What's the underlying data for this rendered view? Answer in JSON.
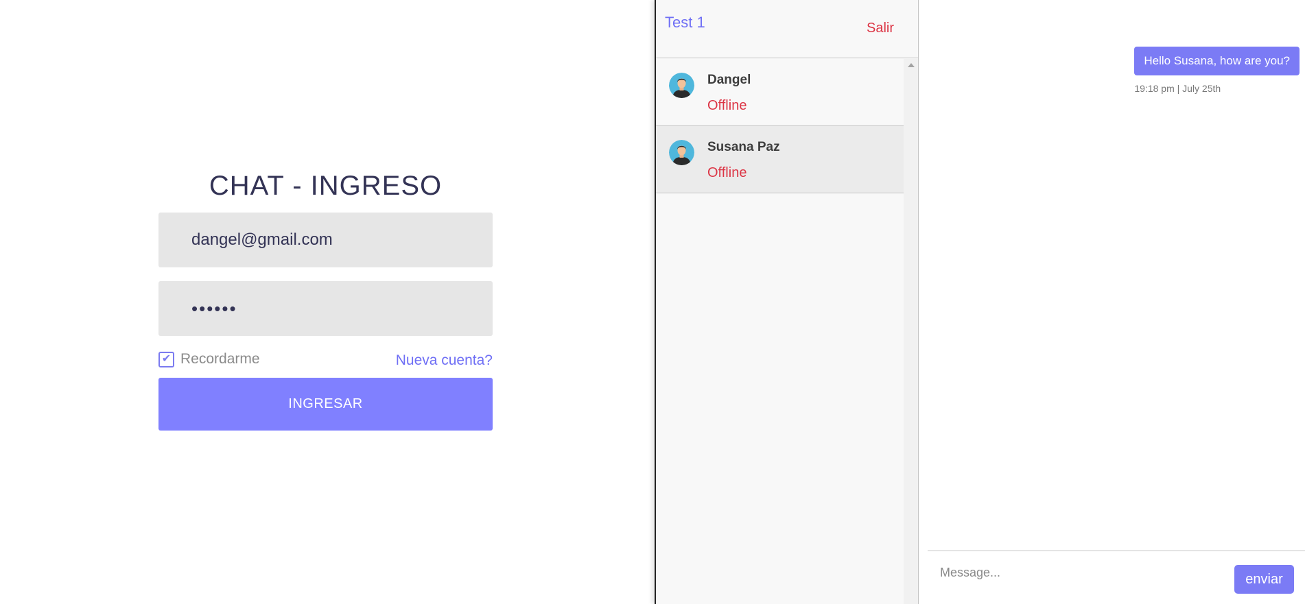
{
  "login": {
    "title": "CHAT - INGRESO",
    "email_value": "dangel@gmail.com",
    "password_value": "••••••",
    "remember_label": "Recordarme",
    "remember_checked": true,
    "new_account_link": "Nueva cuenta?",
    "submit_label": "INGRESAR"
  },
  "users_panel": {
    "current_user": "Test 1",
    "logout_label": "Salir",
    "users": [
      {
        "name": "Dangel",
        "status": "Offline"
      },
      {
        "name": "Susana Paz",
        "status": "Offline"
      }
    ]
  },
  "chat": {
    "messages": [
      {
        "text": "Hello Susana, how are you?",
        "time": "19:18 pm | July 25th"
      }
    ],
    "input_placeholder": "Message...",
    "send_label": "enviar"
  },
  "colors": {
    "accent": "#8080ff",
    "link": "#6f6ff5",
    "offline": "#dc3545",
    "input_bg": "#e6e6e6"
  },
  "icons": {
    "avatar": "user-avatar-icon",
    "check": "check-icon",
    "scroll_up": "scroll-up-arrow-icon"
  }
}
